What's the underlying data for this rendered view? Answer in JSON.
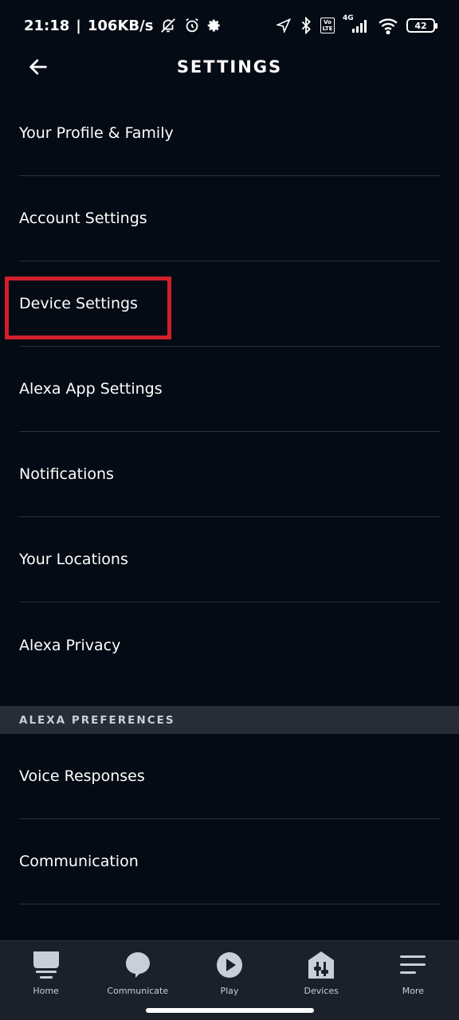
{
  "status_bar": {
    "time": "21:18",
    "separator": "|",
    "network_speed": "106KB/s",
    "network_type": "4G",
    "volte": "Vo LTE",
    "battery": "42"
  },
  "header": {
    "title": "SETTINGS"
  },
  "menu": {
    "items": [
      {
        "label": "Your Profile & Family"
      },
      {
        "label": "Account Settings"
      },
      {
        "label": "Device Settings"
      },
      {
        "label": "Alexa App Settings"
      },
      {
        "label": "Notifications"
      },
      {
        "label": "Your Locations"
      },
      {
        "label": "Alexa Privacy"
      }
    ]
  },
  "section": {
    "title": "ALEXA PREFERENCES"
  },
  "preferences": {
    "items": [
      {
        "label": "Voice Responses"
      },
      {
        "label": "Communication"
      }
    ]
  },
  "bottom_nav": {
    "items": [
      {
        "label": "Home",
        "icon": "home-icon"
      },
      {
        "label": "Communicate",
        "icon": "chat-bubble-icon"
      },
      {
        "label": "Play",
        "icon": "play-icon"
      },
      {
        "label": "Devices",
        "icon": "devices-icon"
      },
      {
        "label": "More",
        "icon": "menu-icon"
      }
    ]
  },
  "colors": {
    "background": "#050b14",
    "divider": "#2a313a",
    "highlight": "#d0202b",
    "section_bg": "#262d36",
    "nav_bg": "#1b212a"
  }
}
